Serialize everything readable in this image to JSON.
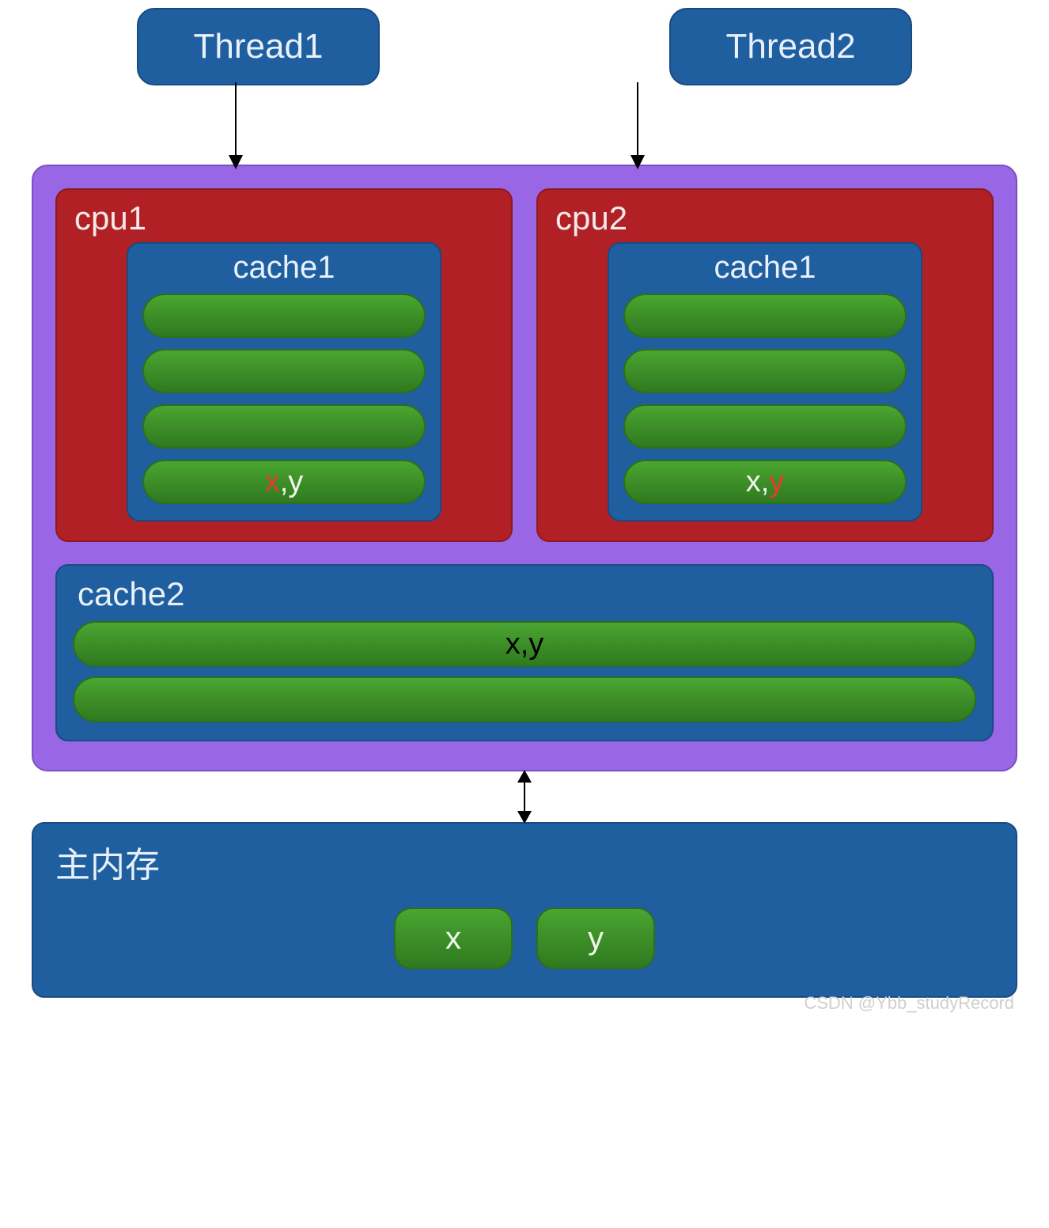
{
  "threads": {
    "t1": "Thread1",
    "t2": "Thread2"
  },
  "cpu1": {
    "label": "cpu1",
    "cache_label": "cache1",
    "line_x": "x",
    "line_sep": ",",
    "line_y": "y"
  },
  "cpu2": {
    "label": "cpu2",
    "cache_label": "cache1",
    "line_x": "x",
    "line_sep": ",",
    "line_y": "y"
  },
  "cache2": {
    "label": "cache2",
    "line_text": "x,y"
  },
  "memory": {
    "label": "主内存",
    "var_x": "x",
    "var_y": "y"
  },
  "watermark": "CSDN @Ybb_studyRecord"
}
